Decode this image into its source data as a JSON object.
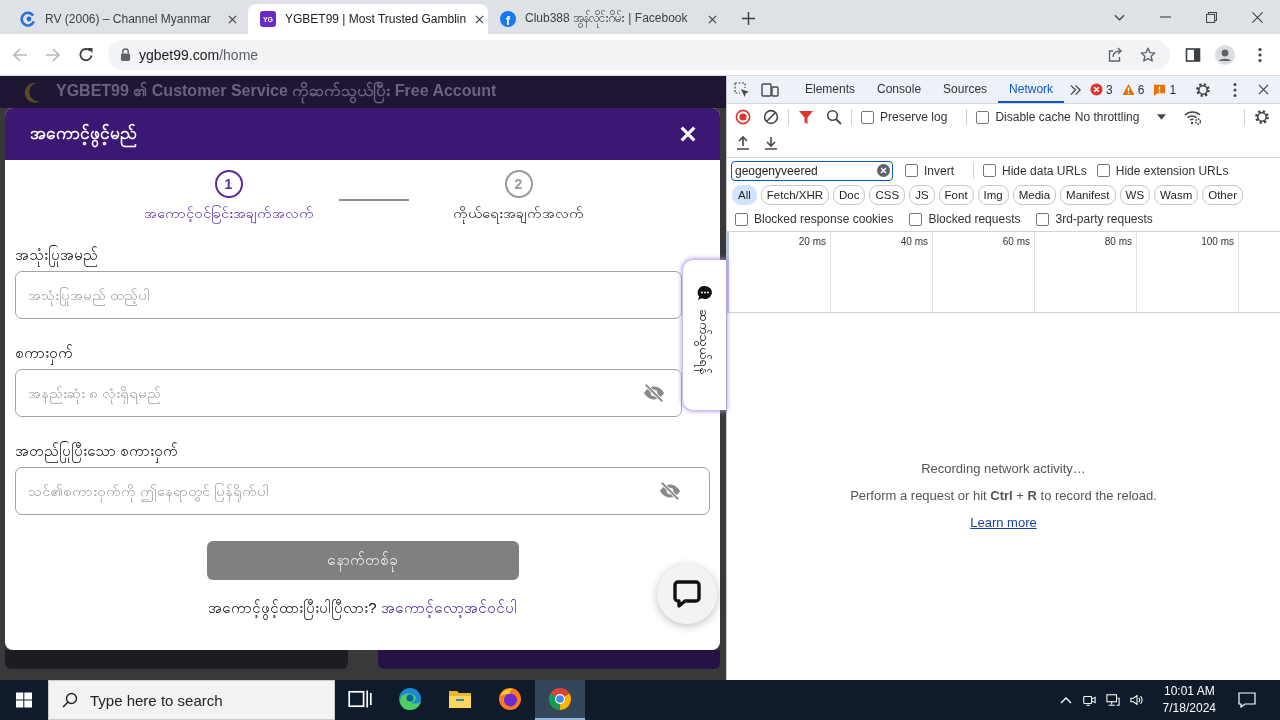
{
  "browser": {
    "tabs": [
      {
        "title": "RV (2006) – Channel Myanmar",
        "selected": false,
        "favicon": {
          "kind": "ring"
        }
      },
      {
        "title": "YGBET99 | Most Trusted Gamblin",
        "selected": true,
        "favicon": {
          "kind": "square",
          "text": "YG"
        }
      },
      {
        "title": "Club388 အွန်လိုင်းဂိမ်း | Facebook",
        "selected": false,
        "favicon": {
          "kind": "round",
          "text": "f"
        }
      }
    ],
    "back_disabled": true,
    "forward_disabled": true,
    "address": {
      "domain": "ygbet99.com",
      "path": "/home"
    }
  },
  "page": {
    "banner": "YGBET99 ၏ Customer Service ကိုဆက်သွယ်ပြီး Free Account",
    "modal": {
      "title": "အကောင့်ဖွင့်မည်",
      "steps": [
        {
          "number": "1",
          "label": "အကောင့်ဝင်ခြင်းအချက်အလက်",
          "selected": true
        },
        {
          "number": "2",
          "label": "ကိုယ်ရေးအချက်အလက်",
          "selected": false
        }
      ],
      "fields": [
        {
          "kind": "text",
          "label": "အသုံးပြုအမည်",
          "placeholder": "အသုံးပြုအမည် ထည့်ပါ"
        },
        {
          "kind": "password",
          "label": "စကားဝှက်",
          "placeholder": "အနည်းဆုံး ၈ လုံးရှိရမည်"
        },
        {
          "kind": "password",
          "label": "အတည်ပြုပြီးသော စကားဝှက်",
          "placeholder": "သင်၏စကားဝှက်ကို ဤနေရာတွင် ပြန်ရိုက်ပါ"
        }
      ],
      "submit": {
        "label": "နောက်တစ်ခု",
        "disabled": true
      },
      "footer": {
        "question": "အကောင့်ဖွင့်ထားပြီးပါပြီလား?",
        "link": "အကောင့်လော့အင်ဝင်ပါ"
      }
    },
    "side_tab": "ဆက်သွယ်ရန်"
  },
  "devtools": {
    "tabs": [
      {
        "label": "Elements",
        "selected": false
      },
      {
        "label": "Console",
        "selected": false
      },
      {
        "label": "Sources",
        "selected": false
      },
      {
        "label": "Network",
        "selected": true
      }
    ],
    "issues": [
      {
        "kind": "error",
        "count": "3"
      },
      {
        "kind": "warning",
        "count": "6"
      },
      {
        "kind": "info",
        "count": "1"
      }
    ],
    "recording": true,
    "filter_active": true,
    "options": [
      {
        "label": "Preserve log",
        "checked": false
      },
      {
        "label": "Disable cache",
        "checked": false
      }
    ],
    "throttling": "No throttling",
    "filter": {
      "value": "geogenyveered"
    },
    "filter_options": [
      {
        "label": "Invert",
        "checked": false
      },
      {
        "label": "Hide data URLs",
        "checked": false
      },
      {
        "label": "Hide extension URLs",
        "checked": false
      }
    ],
    "types": [
      {
        "label": "All",
        "selected": true
      },
      {
        "label": "Fetch/XHR",
        "selected": false
      },
      {
        "label": "Doc",
        "selected": false
      },
      {
        "label": "CSS",
        "selected": false
      },
      {
        "label": "JS",
        "selected": false
      },
      {
        "label": "Font",
        "selected": false
      },
      {
        "label": "Img",
        "selected": false
      },
      {
        "label": "Media",
        "selected": false
      },
      {
        "label": "Manifest",
        "selected": false
      },
      {
        "label": "WS",
        "selected": false
      },
      {
        "label": "Wasm",
        "selected": false
      },
      {
        "label": "Other",
        "selected": false
      }
    ],
    "blocked_options": [
      {
        "label": "Blocked response cookies",
        "checked": false
      },
      {
        "label": "Blocked requests",
        "checked": false
      },
      {
        "label": "3rd-party requests",
        "checked": false
      }
    ],
    "timeline_ticks": [
      "20 ms",
      "40 ms",
      "60 ms",
      "80 ms",
      "100 ms"
    ],
    "empty": {
      "title": "Recording network activity…",
      "hint": "Perform a request or hit **Ctrl** + **R** to record the reload.",
      "link": "Learn more"
    }
  },
  "taskbar": {
    "search_placeholder": "Type here to search",
    "apps": [
      {
        "kind": "taskview",
        "selected": false
      },
      {
        "kind": "edge",
        "selected": false
      },
      {
        "kind": "explorer",
        "selected": false
      },
      {
        "kind": "firefox",
        "selected": false
      },
      {
        "kind": "chrome",
        "selected": true
      }
    ],
    "time": "10:01 AM",
    "date": "7/18/2024"
  }
}
